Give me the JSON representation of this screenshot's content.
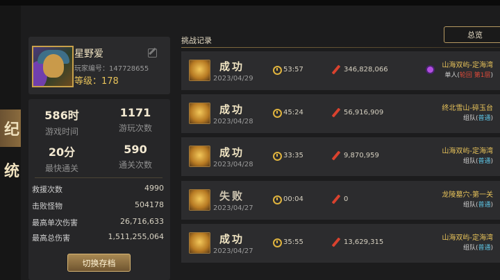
{
  "nav": {
    "tabs": [
      {
        "glyph": "纪",
        "active": true
      },
      {
        "glyph": "统",
        "active": false
      }
    ]
  },
  "profile": {
    "name": "星野爱",
    "player_id": "玩家编号：147728655",
    "level": "等级：178"
  },
  "stats": {
    "grid": [
      {
        "value": "586时",
        "label": "游戏时间"
      },
      {
        "value": "1171",
        "label": "游玩次数"
      },
      {
        "value": "20分",
        "label": "最快通关"
      },
      {
        "value": "590",
        "label": "通关次数"
      }
    ],
    "rows": [
      {
        "key": "救援次数",
        "value": "4990"
      },
      {
        "key": "击败怪物",
        "value": "504178"
      },
      {
        "key": "最高单次伤害",
        "value": "26,716,633"
      },
      {
        "key": "最高总伤害",
        "value": "1,511,255,064"
      }
    ],
    "switch_label": "切换存档"
  },
  "records": {
    "title": "挑战记录",
    "overview_label": "总览",
    "items": [
      {
        "result": "成功",
        "date": "2023/04/29",
        "time": "53:57",
        "damage": "346,828,066",
        "stage": "山海双屿-定海湾",
        "mode_a": "单人(",
        "mode_b": "轮回 第1层",
        "mode_c": ")",
        "mode_style": "red"
      },
      {
        "result": "成功",
        "date": "2023/04/28",
        "time": "45:24",
        "damage": "56,916,909",
        "stage": "终北雪山-碎玉台",
        "mode_a": "组队(",
        "mode_b": "普通",
        "mode_c": ")",
        "mode_style": "hl"
      },
      {
        "result": "成功",
        "date": "2023/04/28",
        "time": "33:35",
        "damage": "9,870,959",
        "stage": "山海双屿-定海湾",
        "mode_a": "组队(",
        "mode_b": "普通",
        "mode_c": ")",
        "mode_style": "hl"
      },
      {
        "result": "失败",
        "date": "2023/04/27",
        "time": "00:04",
        "damage": "0",
        "stage": "龙陵墓穴-第一关",
        "mode_a": "组队(",
        "mode_b": "普通",
        "mode_c": ")",
        "mode_style": "hl"
      },
      {
        "result": "成功",
        "date": "2023/04/27",
        "time": "35:55",
        "damage": "13,629,315",
        "stage": "山海双屿-定海湾",
        "mode_a": "组队(",
        "mode_b": "普通",
        "mode_c": ")",
        "mode_style": "hl"
      }
    ]
  }
}
